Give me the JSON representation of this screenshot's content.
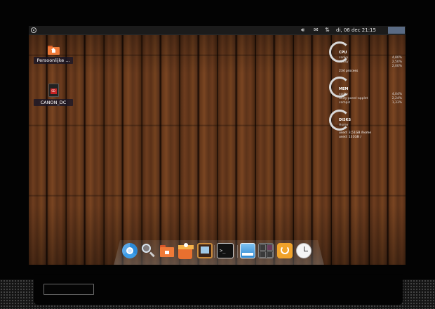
{
  "panel": {
    "clock": "di, 06 dec  21:15",
    "indicators": [
      "volume-icon",
      "mail-icon",
      "network-icon"
    ]
  },
  "desktop_icons": [
    {
      "label": "Persoonlijke ...",
      "icon": "home-folder-icon"
    },
    {
      "label": "CANON_DC",
      "icon": "sd-card-icon",
      "badge": "SD"
    }
  ],
  "conky": {
    "cpu": {
      "title": "CPU",
      "rows": [
        {
          "name": "conky",
          "value": "4,80%"
        },
        {
          "name": "dbusy",
          "value": "2,50%"
        },
        {
          "name": "",
          "value": "2,00%"
        }
      ],
      "processes": "234 process"
    },
    "mem": {
      "title": "MEM",
      "rows": [
        {
          "name": "conky",
          "value": "4,04%"
        },
        {
          "name": "unity-panel-applet",
          "value": "2,24%"
        },
        {
          "name": "compiz",
          "value": "1,33%"
        }
      ]
    },
    "disks": {
      "title": "DISKS",
      "rows": [
        {
          "name": "Home",
          "value": ""
        },
        {
          "name": "used: 3,51GB /home",
          "value": ""
        },
        {
          "name": "used: 131GB /",
          "value": ""
        }
      ]
    }
  },
  "dock": {
    "items": [
      "chrome-icon",
      "search-icon",
      "files-icon",
      "package-icon",
      "tv-icon",
      "terminal-icon",
      "window-icon",
      "workspaces-icon",
      "power-icon",
      "clock-icon"
    ],
    "terminal_glyph": ">_"
  },
  "colors": {
    "wood": "#5b3319",
    "panel": "#1b1b1b",
    "folder_orange": "#f07a38",
    "user_box": "#5a6b84"
  }
}
